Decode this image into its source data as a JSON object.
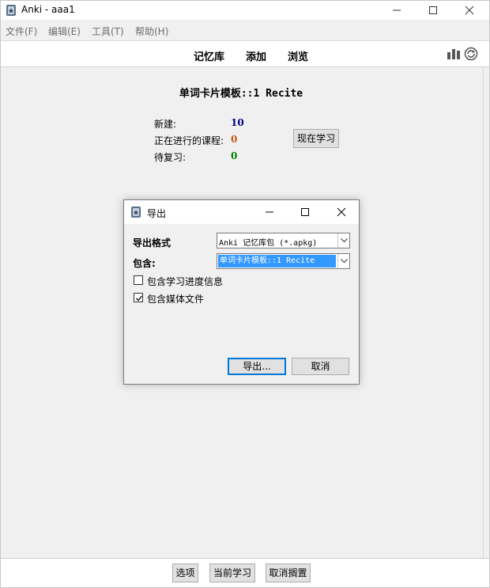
{
  "window": {
    "title": "Anki - aaa1"
  },
  "menubar": {
    "items": [
      "文件(F)",
      "编辑(E)",
      "工具(T)",
      "帮助(H)"
    ]
  },
  "toolbar": {
    "links": [
      "记忆库",
      "添加",
      "浏览"
    ],
    "icons": [
      "stats-icon",
      "sync-icon"
    ]
  },
  "overview": {
    "deck_title": "单词卡片模板::1 Recite",
    "stats": [
      {
        "label": "新建:",
        "value": "10",
        "color": "#00008b"
      },
      {
        "label": "正在进行的课程:",
        "value": "0",
        "color": "#c35617"
      },
      {
        "label": "待复习:",
        "value": "0",
        "color": "#008000"
      }
    ],
    "study_button": "现在学习"
  },
  "export_dialog": {
    "title": "导出",
    "format_label": "导出格式",
    "format_value": "Anki 记忆库包 (*.apkg)",
    "include_label": "包含:",
    "include_value": "单词卡片模板::1 Recite",
    "checkboxes": [
      {
        "label": "包含学习进度信息",
        "checked": false
      },
      {
        "label": "包含媒体文件",
        "checked": true
      }
    ],
    "export_button": "导出...",
    "cancel_button": "取消"
  },
  "bottombar": {
    "buttons": [
      "选项",
      "当前学习",
      "取消搁置"
    ]
  },
  "colors": {
    "selection": "#3399ff",
    "default_button_border": "#0078d7"
  }
}
